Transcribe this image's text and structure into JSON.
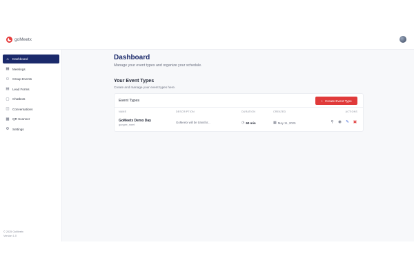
{
  "brand": {
    "name": "goMeetx"
  },
  "sidebar": {
    "items": [
      {
        "label": "Dashboard",
        "icon": "home-icon",
        "glyph": "⌂",
        "active": true
      },
      {
        "label": "Meetings",
        "icon": "calendar-icon",
        "glyph": "▦"
      },
      {
        "label": "Group Events",
        "icon": "group-icon",
        "glyph": "⚇"
      },
      {
        "label": "Lead Forms",
        "icon": "form-icon",
        "glyph": "▤"
      },
      {
        "label": "Chatbots",
        "icon": "chat-icon",
        "glyph": "▢"
      },
      {
        "label": "Conversations",
        "icon": "conversation-icon",
        "glyph": "◫"
      },
      {
        "label": "QR Scanner",
        "icon": "qr-icon",
        "glyph": "▩"
      },
      {
        "label": "Settings",
        "icon": "gear-icon",
        "glyph": "⚙"
      }
    ],
    "footer": {
      "copyright": "© 2025 GoMeetx",
      "version": "Version 1.0"
    }
  },
  "main": {
    "title": "Dashboard",
    "subtitle": "Manage your event types and organize your schedule.",
    "section_title": "Your Event Types",
    "section_subtitle": "Create and manage your event types here.",
    "card": {
      "title": "Event Types",
      "create_label": "Create Event Type",
      "columns": {
        "name": "NAME",
        "description": "DESCRIPTION",
        "duration": "DURATION",
        "created": "CREATED",
        "actions": "ACTIONS"
      },
      "rows": [
        {
          "name": "GoMeetx Demo Day",
          "slug": "gungee_meet",
          "description": "GoMeetx will be transfor...",
          "duration": "60 min",
          "created": "May 11, 2025"
        }
      ]
    }
  },
  "colors": {
    "accent": "#1b2a6b",
    "primary_button": "#e03a3a",
    "edit": "#3b63d6"
  }
}
